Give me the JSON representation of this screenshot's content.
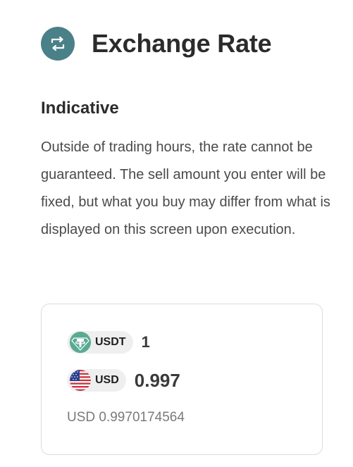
{
  "header": {
    "title": "Exchange Rate",
    "icon": "exchange-icon",
    "icon_color": "#4a8188"
  },
  "notice": {
    "title": "Indicative",
    "body": "Outside of trading hours, the rate cannot be guaranteed. The sell amount you enter will be fixed, but what you buy may differ from what is displayed on this screen upon execution."
  },
  "rate_card": {
    "from": {
      "currency": "USDT",
      "icon": "tether-icon",
      "icon_color": "#5aaa93",
      "amount": "1"
    },
    "to": {
      "currency": "USD",
      "icon": "us-flag-icon",
      "amount": "0.997"
    },
    "precise_rate": "USD 0.9970174564"
  }
}
